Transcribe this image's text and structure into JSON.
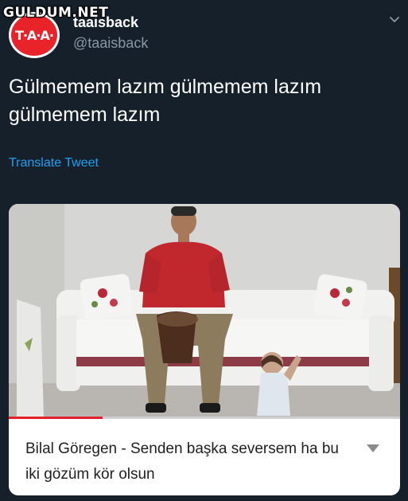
{
  "watermark": "GULDUM.NET",
  "author": {
    "avatar_text": "T·A·A·",
    "display_name": "taaisback",
    "handle": "@taaisback"
  },
  "tweet": {
    "text": "Gülmemem lazım gülmemem lazım gülmemem lazım",
    "translate_label": "Translate Tweet"
  },
  "video": {
    "caption": "Bilal Göregen - Senden başka seversem ha bu  iki gözüm kör olsun",
    "progress": 0.24
  },
  "colors": {
    "background": "#15202b",
    "link": "#1da1f2",
    "secondary_text": "#8899a6",
    "progress": "#e4202a"
  },
  "icons": {
    "menu": "chevron-down-icon",
    "expand": "triangle-down-icon"
  }
}
